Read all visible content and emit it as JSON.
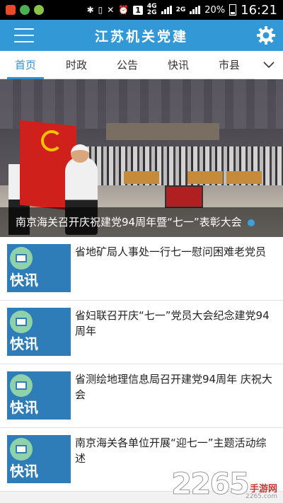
{
  "status_bar": {
    "network_top": "4G",
    "network_bottom": "2G",
    "network2": "2G",
    "sim": "1",
    "battery": "20%",
    "time": "16:21"
  },
  "header": {
    "title": "江苏机关党建",
    "colors": {
      "header_bg": "#3399d6",
      "accent": "#2f8fd1"
    }
  },
  "tabs": [
    {
      "label": "首页",
      "active": true
    },
    {
      "label": "时政",
      "active": false
    },
    {
      "label": "公告",
      "active": false
    },
    {
      "label": "快讯",
      "active": false
    },
    {
      "label": "市县",
      "active": false
    }
  ],
  "banner": {
    "caption": "南京海关召开庆祝建党94周年暨“七一”表彰大会"
  },
  "news": [
    {
      "thumb_label": "快讯",
      "title": "省地矿局人事处一行七一慰问困难老党员"
    },
    {
      "thumb_label": "快讯",
      "title": "省妇联召开庆“七一”党员大会纪念建党94周年"
    },
    {
      "thumb_label": "快讯",
      "title": "省测绘地理信息局召开建党94周年 庆祝大会"
    },
    {
      "thumb_label": "快讯",
      "title": "南京海关各单位开展“迎七一”主题活动综述"
    }
  ],
  "watermark": {
    "digits": "2265",
    "text": "手游网",
    "url": "2265.com"
  }
}
